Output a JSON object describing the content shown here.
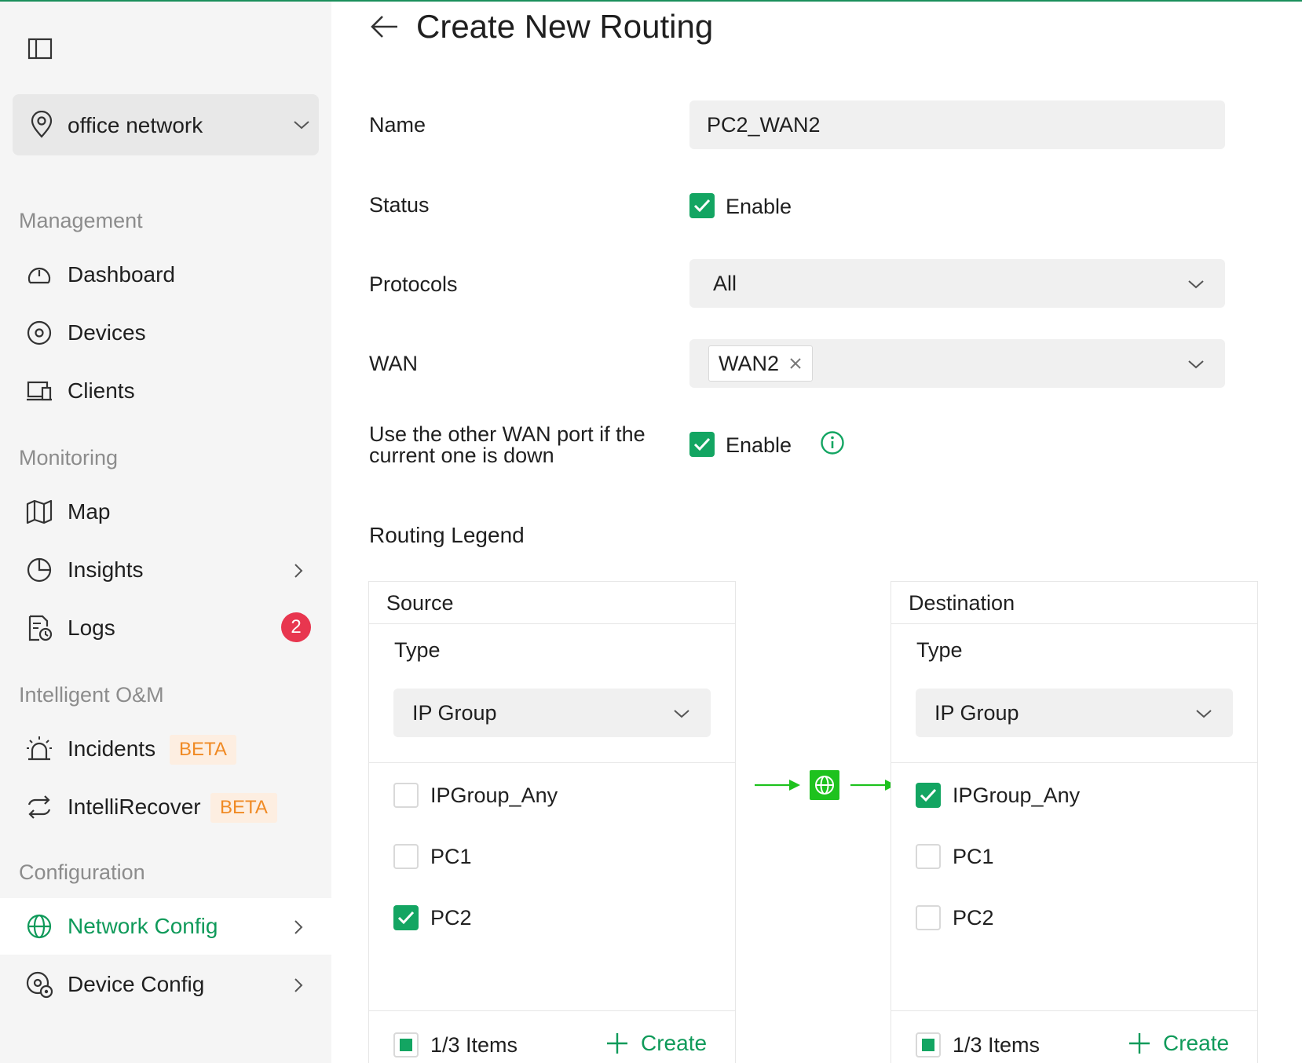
{
  "colors": {
    "accent": "#13a562",
    "accent_text": "#0f9a5a",
    "badge": "#e8364f",
    "beta_bg": "#fdeee1",
    "beta_text": "#f08a24",
    "flow_green": "#1ec21e"
  },
  "sidebar": {
    "toggle_icon": "sidebar-toggle-icon",
    "site": {
      "icon": "location-pin-icon",
      "label": "office network",
      "chevron": "chevron-down-icon"
    },
    "sections": [
      {
        "title": "Management"
      },
      {
        "title": "Monitoring"
      },
      {
        "title": "Intelligent O&M"
      },
      {
        "title": "Configuration"
      }
    ],
    "items": [
      {
        "label": "Dashboard",
        "icon": "gauge-icon"
      },
      {
        "label": "Devices",
        "icon": "device-icon"
      },
      {
        "label": "Clients",
        "icon": "clients-icon"
      },
      {
        "label": "Map",
        "icon": "map-icon"
      },
      {
        "label": "Insights",
        "icon": "pie-chart-icon"
      },
      {
        "label": "Logs",
        "icon": "logs-icon",
        "badge": "2"
      },
      {
        "label": "Incidents",
        "icon": "alarm-icon",
        "tag": "BETA"
      },
      {
        "label": "IntelliRecover",
        "icon": "recover-icon",
        "tag": "BETA"
      },
      {
        "label": "Network Config",
        "icon": "globe-icon",
        "active": true
      },
      {
        "label": "Device Config",
        "icon": "device-config-icon"
      }
    ]
  },
  "page": {
    "title": "Create New Routing",
    "back_icon": "arrow-left-icon"
  },
  "form": {
    "name": {
      "label": "Name",
      "value": "PC2_WAN2"
    },
    "status": {
      "label": "Status",
      "checkbox_label": "Enable",
      "checked": true
    },
    "protocols": {
      "label": "Protocols",
      "value": "All"
    },
    "wan": {
      "label": "WAN",
      "tags": [
        "WAN2"
      ]
    },
    "failover": {
      "label_line1": "Use the other WAN port if the",
      "label_line2": "current one is down",
      "checkbox_label": "Enable",
      "checked": true,
      "info_icon": "info-icon"
    }
  },
  "legend": {
    "title": "Routing Legend",
    "flow_icon": "globe-icon",
    "source": {
      "header": "Source",
      "type_label": "Type",
      "type_value": "IP Group",
      "options": [
        {
          "label": "IPGroup_Any",
          "checked": false
        },
        {
          "label": "PC1",
          "checked": false
        },
        {
          "label": "PC2",
          "checked": true
        }
      ],
      "footer_count": "1/3 Items",
      "create_label": "Create"
    },
    "destination": {
      "header": "Destination",
      "type_label": "Type",
      "type_value": "IP Group",
      "options": [
        {
          "label": "IPGroup_Any",
          "checked": true
        },
        {
          "label": "PC1",
          "checked": false
        },
        {
          "label": "PC2",
          "checked": false
        }
      ],
      "footer_count": "1/3 Items",
      "create_label": "Create"
    }
  }
}
